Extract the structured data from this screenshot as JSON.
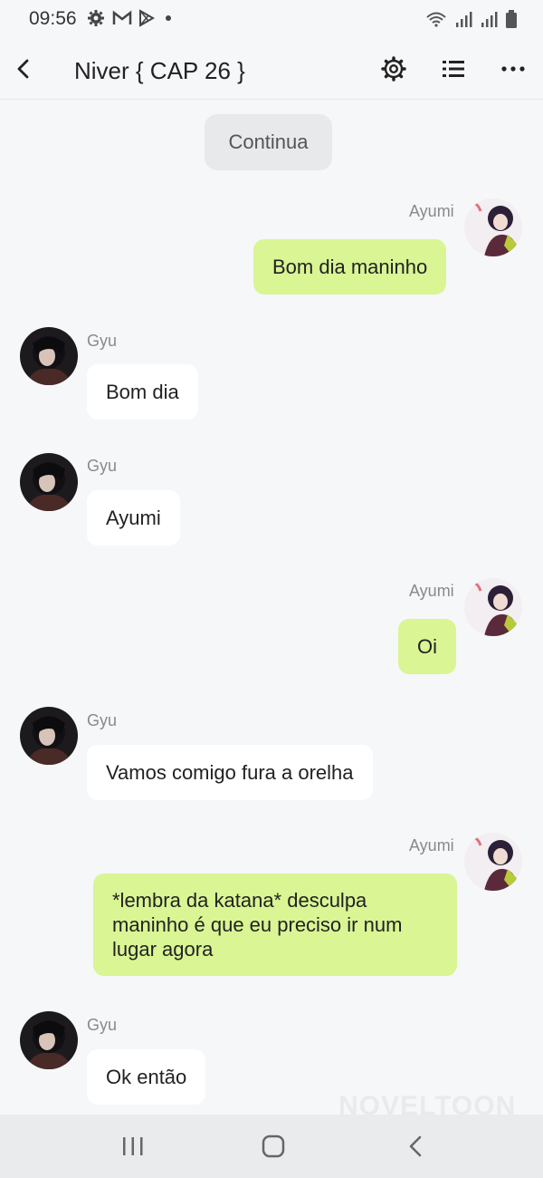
{
  "status_bar": {
    "time": "09:56",
    "icons": [
      "settings-gear-icon",
      "gmail-icon",
      "play-store-icon",
      "dot-icon",
      "wifi-icon",
      "signal-icon",
      "signal-icon",
      "battery-icon"
    ]
  },
  "header": {
    "title": "Niver { CAP 26 }",
    "icons": [
      "back-arrow-icon",
      "settings-icon",
      "list-icon",
      "more-icon"
    ]
  },
  "chat": {
    "continue_label": "Continua",
    "messages": [
      {
        "sender": "Ayumi",
        "text": "Bom dia maninho",
        "side": "right"
      },
      {
        "sender": "Gyu",
        "text": "Bom dia",
        "side": "left"
      },
      {
        "sender": "Gyu",
        "text": "Ayumi",
        "side": "left"
      },
      {
        "sender": "Ayumi",
        "text": "Oi",
        "side": "right"
      },
      {
        "sender": "Gyu",
        "text": "Vamos comigo fura a orelha",
        "side": "left"
      },
      {
        "sender": "Ayumi",
        "text": "*lembra da katana* desculpa maninho é que eu preciso ir num lugar agora",
        "side": "right"
      },
      {
        "sender": "Gyu",
        "text": "Ok então",
        "side": "left"
      }
    ]
  },
  "watermark": "NOVELTOON",
  "colors": {
    "background": "#f6f7f9",
    "right_bubble": "#d9f594",
    "left_bubble": "#ffffff",
    "continue_button": "#e8e9eb"
  }
}
